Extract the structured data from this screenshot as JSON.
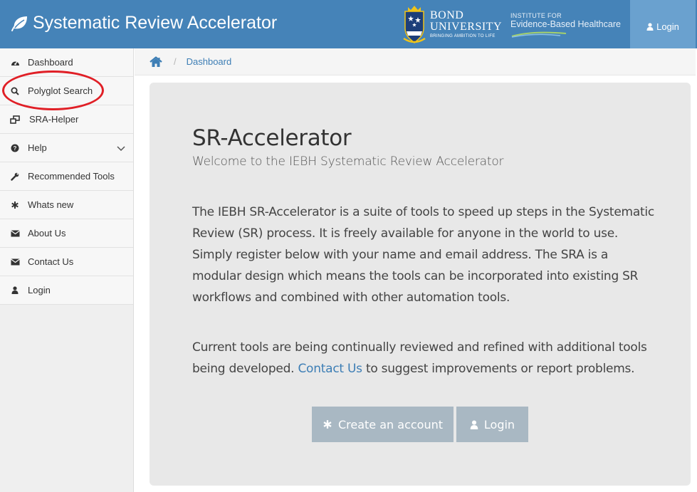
{
  "header": {
    "brand_title": "Systematic Review Accelerator",
    "bond_line1": "BOND",
    "bond_line2": "UNIVERSITY",
    "bond_tagline": "BRINGING AMBITION TO LIFE",
    "iebh_line1": "INSTITUTE FOR",
    "iebh_line2": "Evidence-Based Healthcare",
    "login_label": "Login",
    "colors": {
      "bar": "#4583b8",
      "login_bg": "#6aa1cf"
    }
  },
  "sidebar": {
    "items": [
      {
        "label": "Dashboard",
        "icon": "dashboard-icon"
      },
      {
        "label": "Polyglot Search",
        "icon": "search-icon"
      },
      {
        "label": "SRA-Helper",
        "icon": "windows-icon"
      },
      {
        "label": "Help",
        "icon": "question-circle-icon",
        "expandable": true
      },
      {
        "label": "Recommended Tools",
        "icon": "wrench-icon"
      },
      {
        "label": "Whats new",
        "icon": "asterisk-icon"
      },
      {
        "label": "About Us",
        "icon": "envelope-icon"
      },
      {
        "label": "Contact Us",
        "icon": "envelope-icon"
      },
      {
        "label": "Login",
        "icon": "user-icon"
      }
    ],
    "annotation_color": "#e01f26"
  },
  "breadcrumb": {
    "items": [
      "Dashboard"
    ]
  },
  "main": {
    "title": "SR-Accelerator",
    "subtitle": "Welcome to the IEBH Systematic Review Accelerator",
    "paragraph1": "The IEBH SR-Accelerator is a suite of tools to speed up steps in the Systematic Review (SR) process. It is freely available for anyone in the world to use. Simply register below with your name and email address. The SRA is a modular design which means the tools can be incorporated into existing SR workflows and combined with other automation tools.",
    "paragraph2_before": "Current tools are being continually reviewed and refined with additional tools being developed. ",
    "paragraph2_link": "Contact Us",
    "paragraph2_after": " to suggest improvements or report problems.",
    "create_account_label": "Create an account",
    "login_label": "Login"
  }
}
